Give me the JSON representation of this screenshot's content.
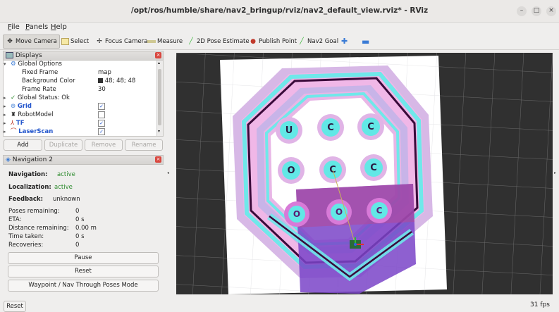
{
  "window": {
    "title": "/opt/ros/humble/share/nav2_bringup/rviz/nav2_default_view.rviz* - RViz",
    "controls": [
      "–",
      "□",
      "×"
    ]
  },
  "menu": [
    {
      "label": "File",
      "underline": "F",
      "rest": "ile"
    },
    {
      "label": "Panels",
      "underline": "P",
      "rest": "anels"
    },
    {
      "label": "Help",
      "underline": "H",
      "rest": "elp"
    }
  ],
  "toolbar": [
    {
      "label": "Move Camera",
      "icon": "move-camera-icon",
      "active": true
    },
    {
      "label": "Select",
      "icon": "select-icon"
    },
    {
      "label": "Focus Camera",
      "icon": "focus-camera-icon"
    },
    {
      "label": "Measure",
      "icon": "measure-icon"
    },
    {
      "label": "2D Pose Estimate",
      "icon": "pose-estimate-icon",
      "color": "#3cb83c"
    },
    {
      "label": "Publish Point",
      "icon": "publish-point-icon",
      "color": "#c0392b"
    },
    {
      "label": "Nav2 Goal",
      "icon": "nav2-goal-icon",
      "color": "#3cb83c"
    },
    {
      "label": "",
      "icon": "plus-icon"
    },
    {
      "label": "",
      "icon": "minus-icon"
    }
  ],
  "displays": {
    "title": "Displays",
    "rows": [
      {
        "label": "Global Options",
        "value": ""
      },
      {
        "label": "Fixed Frame",
        "value": "map"
      },
      {
        "label": "Background Color",
        "value": "48; 48; 48"
      },
      {
        "label": "Frame Rate",
        "value": "30"
      },
      {
        "label": "Global Status: Ok",
        "value": ""
      },
      {
        "label": "Grid",
        "value": ""
      },
      {
        "label": "RobotModel",
        "value": ""
      },
      {
        "label": "TF",
        "value": ""
      },
      {
        "label": "LaserScan",
        "value": ""
      }
    ],
    "buttons": {
      "add": "Add",
      "duplicate": "Duplicate",
      "remove": "Remove",
      "rename": "Rename"
    }
  },
  "nav2": {
    "title": "Navigation 2",
    "navigation_label": "Navigation:",
    "navigation_value": "active",
    "localization_label": "Localization:",
    "localization_value": "active",
    "feedback_label": "Feedback:",
    "feedback_value": "unknown",
    "stats": [
      {
        "label": "Poses remaining:",
        "value": "0"
      },
      {
        "label": "ETA:",
        "value": "0 s"
      },
      {
        "label": "Distance remaining:",
        "value": "0.00 m"
      },
      {
        "label": "Time taken:",
        "value": "0 s"
      },
      {
        "label": "Recoveries:",
        "value": "0"
      }
    ],
    "pause": "Pause",
    "reset": "Reset",
    "mode": "Waypoint / Nav Through Poses Mode"
  },
  "status": {
    "reset": "Reset",
    "fps": "31 fps"
  },
  "colors": {
    "background": "#303030",
    "accent": "#2255cc",
    "active": "#2b8a2b"
  }
}
